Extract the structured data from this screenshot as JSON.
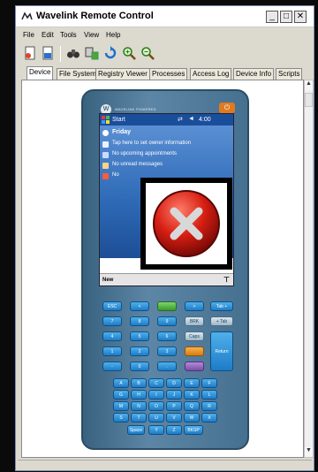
{
  "window": {
    "title": "Wavelink Remote Control",
    "buttons": {
      "minimize": "_",
      "maximize": "□",
      "close": "✕"
    }
  },
  "menu": [
    "File",
    "Edit",
    "Tools",
    "View",
    "Help"
  ],
  "toolbar": [
    "new-doc-icon",
    "export-doc-icon",
    "binoculars-icon",
    "device-connect-icon",
    "refresh-icon",
    "zoom-in-icon",
    "zoom-out-icon"
  ],
  "tabs": [
    "Device",
    "File System",
    "Registry Viewer",
    "Processes",
    "Access Log",
    "Device Info",
    "Scripts"
  ],
  "device": {
    "brand": "WAVELINK POWERED",
    "screen": {
      "start": "Start",
      "time": "4:00",
      "day": "Friday",
      "rows": [
        "Tap here to set owner information",
        "No upcoming appointments",
        "No unread messages",
        "No"
      ],
      "softkey": "New"
    },
    "keys": {
      "row1": [
        "ESC",
        "<",
        "",
        ">",
        "Tab +"
      ],
      "row2": [
        "7",
        "8",
        "9",
        "BRK",
        "+ Tab"
      ],
      "row3": [
        "4",
        "5",
        "6",
        "Caps"
      ],
      "row4": [
        "1",
        "2",
        "3",
        "",
        "Return"
      ],
      "row5": [
        "-",
        "0",
        ".",
        ""
      ],
      "alpha1": [
        "A",
        "B",
        "C",
        "D",
        "E",
        "F"
      ],
      "alpha2": [
        "G",
        "H",
        "I",
        "J",
        "K",
        "L"
      ],
      "alpha3": [
        "M",
        "N",
        "O",
        "P",
        "Q",
        "R"
      ],
      "alpha4": [
        "S",
        "T",
        "U",
        "V",
        "W",
        "X"
      ],
      "alpha5": [
        "Space",
        "Y",
        "Z",
        "BKSP"
      ]
    }
  }
}
